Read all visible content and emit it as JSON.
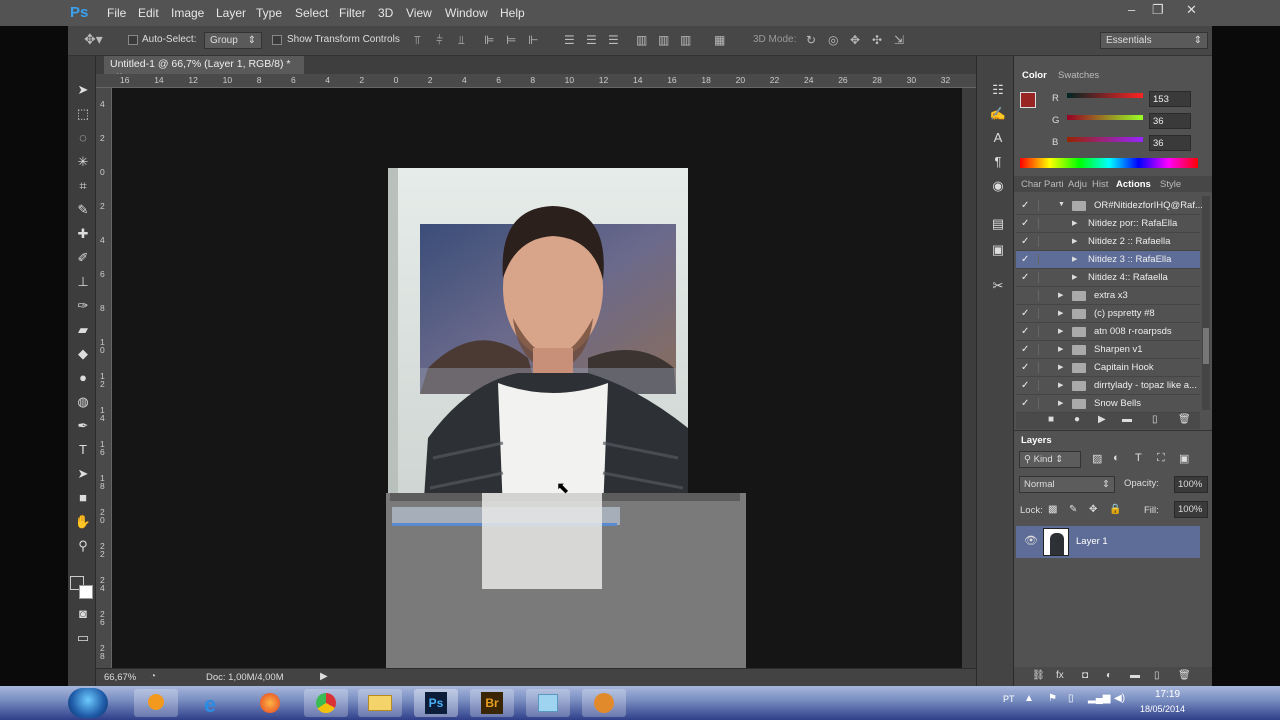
{
  "app": {
    "logo": "Ps",
    "document_tab": "Untitled-1 @ 66,7% (Layer 1, RGB/8) *",
    "tab_close": "×"
  },
  "menu": [
    "File",
    "Edit",
    "Image",
    "Layer",
    "Type",
    "Select",
    "Filter",
    "3D",
    "View",
    "Window",
    "Help"
  ],
  "window_controls": {
    "minimize": "–",
    "restore": "❐",
    "close": "✕"
  },
  "options": {
    "auto_select": "Auto-Select:",
    "group_value": "Group",
    "show_transform": "Show Transform Controls",
    "mode_3d": "3D Mode:",
    "workspace": "Essentials"
  },
  "ruler": {
    "h": [
      "16",
      "14",
      "12",
      "10",
      "8",
      "6",
      "4",
      "2",
      "0",
      "2",
      "4",
      "6",
      "8",
      "10",
      "12",
      "14",
      "16",
      "18",
      "20",
      "22",
      "24",
      "26",
      "28",
      "30",
      "32"
    ],
    "v": [
      "4",
      "2",
      "0",
      "2",
      "4",
      "6",
      "8",
      "1 0",
      "1 2",
      "1 4",
      "1 6",
      "1 8",
      "2 0",
      "2 2",
      "2 4",
      "2 6",
      "2 8"
    ]
  },
  "status": {
    "zoom": "66,67%",
    "doc": "Doc: 1,00M/4,00M",
    "arrow": "▶"
  },
  "color_panel": {
    "tabs": [
      "Color",
      "Swatches"
    ],
    "r_label": "R",
    "g_label": "G",
    "b_label": "B",
    "r": "153",
    "g": "36",
    "b": "36",
    "fg": "#992424"
  },
  "actions_panel": {
    "tabs": [
      "Char",
      "Parti",
      "Adju",
      "Hist",
      "Actions",
      "Style"
    ],
    "rows": [
      {
        "label": "OR#NitidezforIHQ@Raf...",
        "checked": true,
        "indent": 1,
        "open": true,
        "selected": false
      },
      {
        "label": "Nitidez por:: RafaElla",
        "checked": true,
        "indent": 2,
        "open": false,
        "selected": false
      },
      {
        "label": "Nitidez 2 :: Rafaella",
        "checked": true,
        "indent": 2,
        "open": false,
        "selected": false
      },
      {
        "label": "Nitidez 3 :: RafaElla",
        "checked": true,
        "indent": 2,
        "open": false,
        "selected": true
      },
      {
        "label": "Nitidez 4:: Rafaella",
        "checked": true,
        "indent": 2,
        "open": false,
        "selected": false
      },
      {
        "label": "extra x3",
        "checked": false,
        "indent": 1,
        "open": false,
        "selected": false
      },
      {
        "label": "(c) pspretty #8",
        "checked": true,
        "indent": 1,
        "open": false,
        "selected": false
      },
      {
        "label": "atn 008 r-roarpsds",
        "checked": true,
        "indent": 1,
        "open": false,
        "selected": false
      },
      {
        "label": "Sharpen v1",
        "checked": true,
        "indent": 1,
        "open": false,
        "selected": false
      },
      {
        "label": "Capitain Hook",
        "checked": true,
        "indent": 1,
        "open": false,
        "selected": false
      },
      {
        "label": "dirrtylady - topaz like a...",
        "checked": true,
        "indent": 1,
        "open": false,
        "selected": false
      },
      {
        "label": "Snow Bells",
        "checked": true,
        "indent": 1,
        "open": false,
        "selected": false
      }
    ]
  },
  "layers_panel": {
    "title": "Layers",
    "kind": "Kind",
    "blend": "Normal",
    "opacity_label": "Opacity:",
    "opacity": "100%",
    "lock_label": "Lock:",
    "fill_label": "Fill:",
    "fill": "100%",
    "layer_name": "Layer 1"
  },
  "taskbar": {
    "lang": "PT",
    "time": "17:19",
    "date": "18/05/2014",
    "ps": "Ps",
    "br": "Br"
  }
}
